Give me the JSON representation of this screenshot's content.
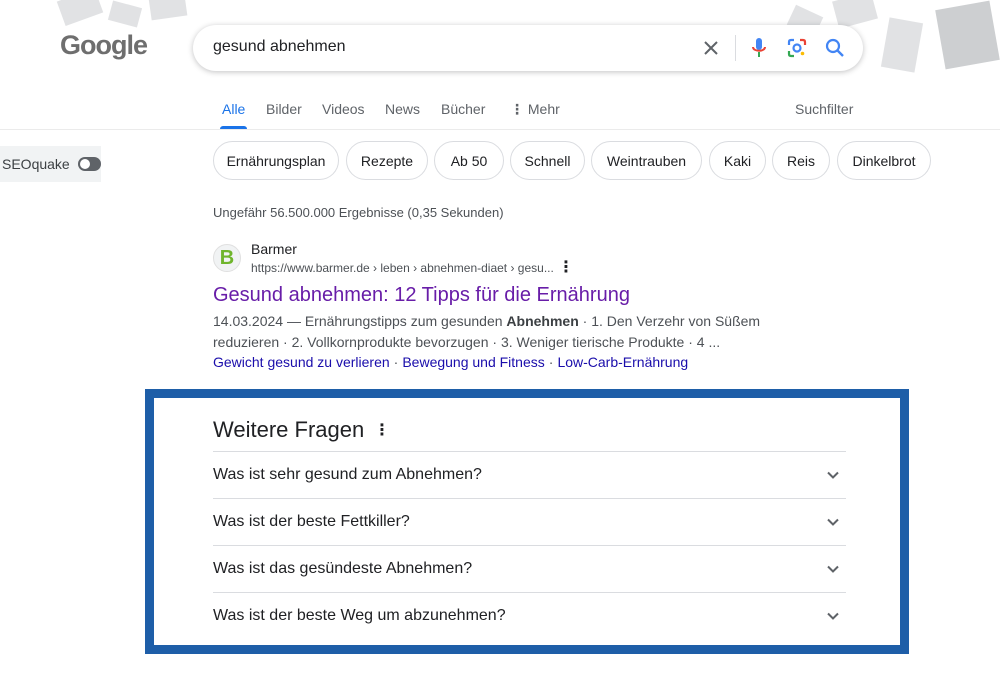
{
  "logo": {
    "text": "Google"
  },
  "search": {
    "query": "gesund abnehmen"
  },
  "tabs": [
    {
      "label": "Alle",
      "active": true
    },
    {
      "label": "Bilder"
    },
    {
      "label": "Videos"
    },
    {
      "label": "News"
    },
    {
      "label": "Bücher"
    },
    {
      "label": "Mehr"
    }
  ],
  "filter_label": "Suchfilter",
  "seoquake": {
    "label": "SEOquake"
  },
  "chips": [
    "Ernährungsplan",
    "Rezepte",
    "Ab 50",
    "Schnell",
    "Weintrauben",
    "Kaki",
    "Reis",
    "Dinkelbrot"
  ],
  "results_count": "Ungefähr 56.500.000 Ergebnisse (0,35 Sekunden)",
  "result": {
    "favicon_letter": "B",
    "site_name": "Barmer",
    "url": "https://www.barmer.de › leben › abnehmen-diaet › gesu...",
    "title": "Gesund abnehmen: 12 Tipps für die Ernährung",
    "snippet_pre": "14.03.2024 — Ernährungstipps zum gesunden ",
    "snippet_bold": "Abnehmen",
    "snippet_post": " · 1. Den Verzehr von Süßem reduzieren · 2. Vollkornprodukte bevorzugen · 3. Weniger tierische Produkte · 4 ...",
    "sitelinks": [
      "Gewicht gesund zu verlieren",
      "Bewegung und Fitness",
      "Low-Carb-Ernährung"
    ]
  },
  "paa": {
    "title": "Weitere Fragen",
    "questions": [
      "Was ist sehr gesund zum Abnehmen?",
      "Was ist der beste Fettkiller?",
      "Was ist das gesündeste Abnehmen?",
      "Was ist der beste Weg um abzunehmen?"
    ]
  },
  "colors": {
    "accent": "#1a73e8",
    "visited_link": "#681da8",
    "frame": "#1e5ea8"
  }
}
